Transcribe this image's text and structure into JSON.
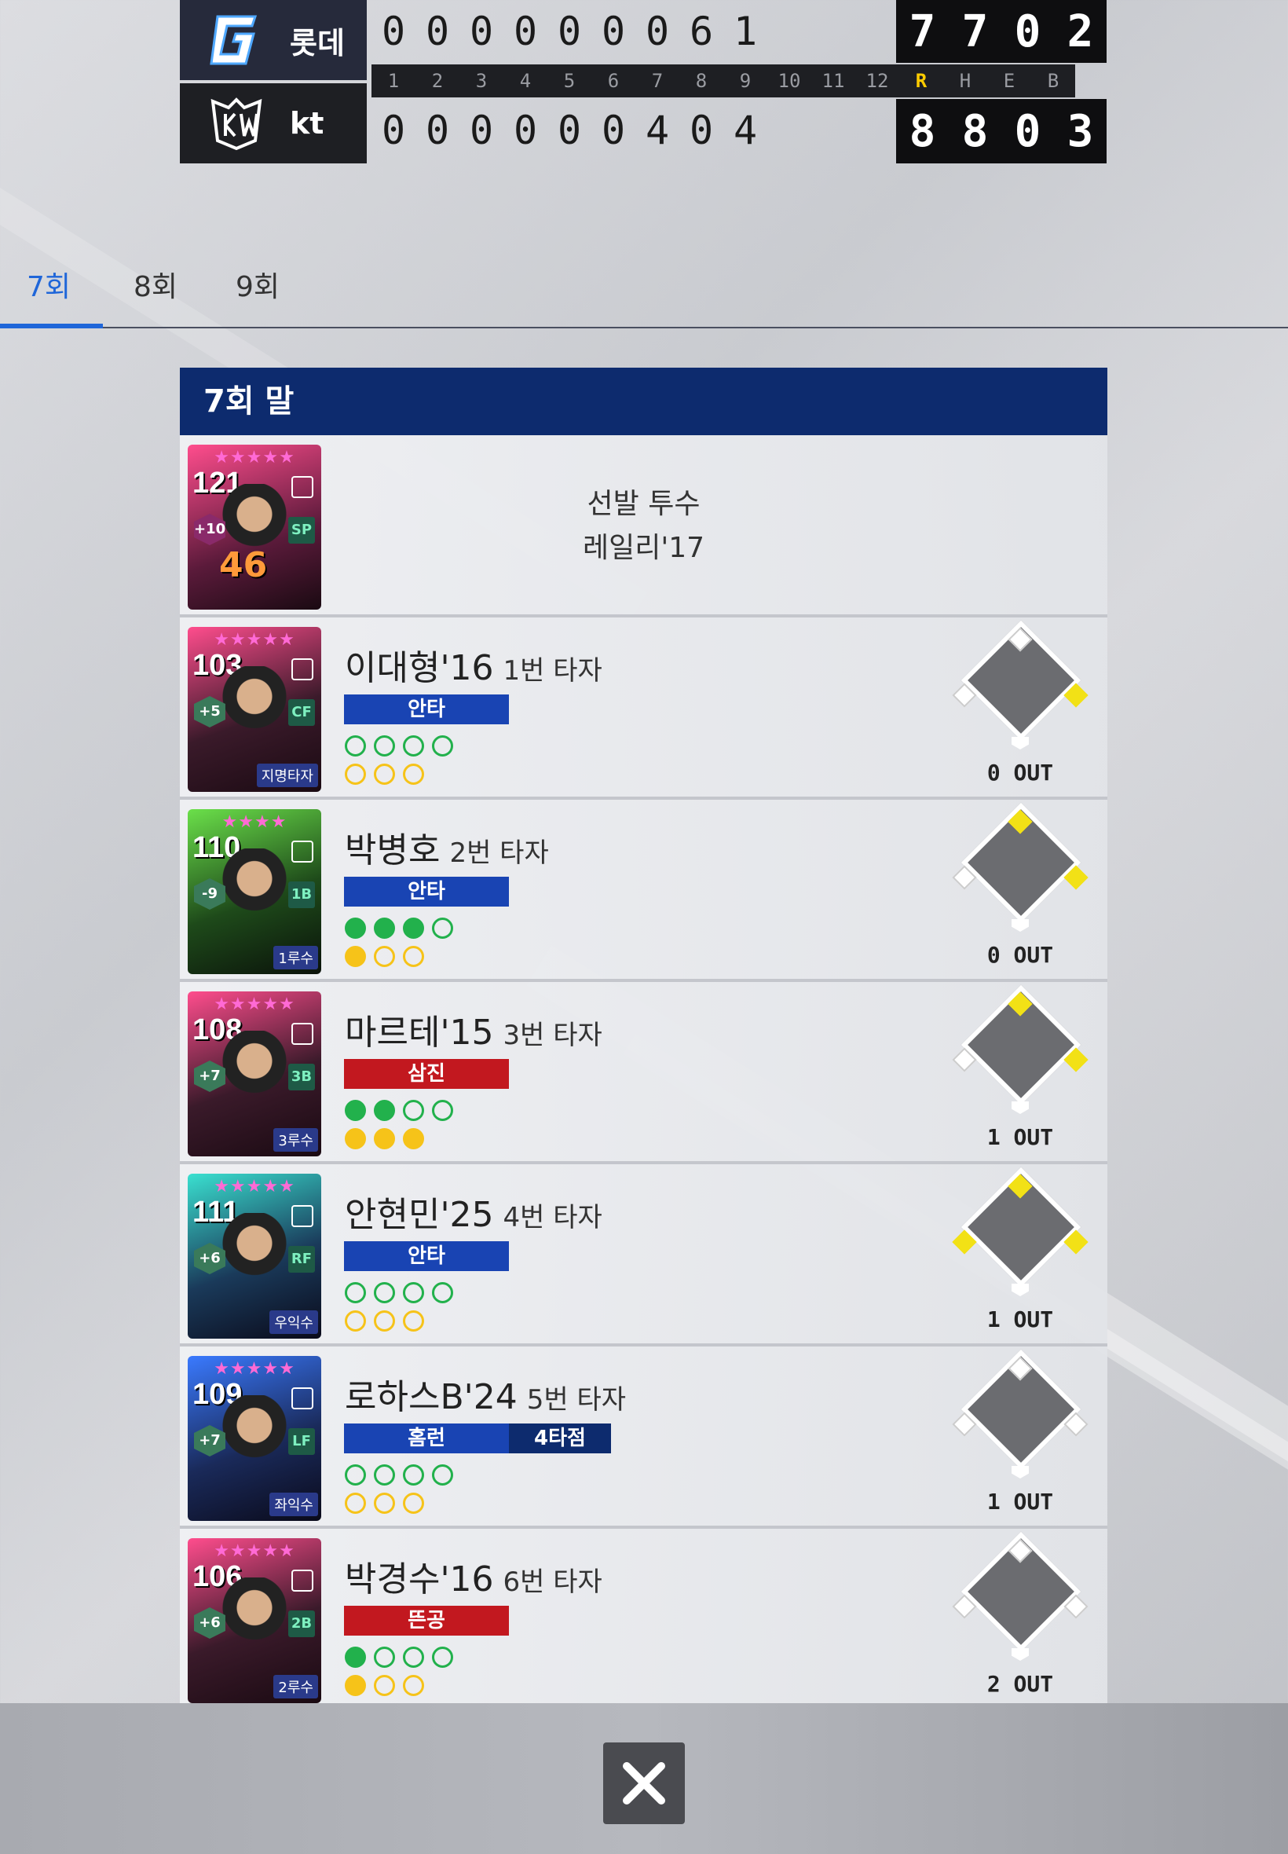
{
  "scoreboard": {
    "away": {
      "name": "롯데",
      "innings": [
        "0",
        "0",
        "0",
        "0",
        "0",
        "0",
        "0",
        "6",
        "1"
      ],
      "totals": [
        "7",
        "7",
        "0",
        "2"
      ]
    },
    "home": {
      "name": "kt",
      "innings": [
        "0",
        "0",
        "0",
        "0",
        "0",
        "0",
        "4",
        "0",
        "4"
      ],
      "totals": [
        "8",
        "8",
        "0",
        "3"
      ]
    },
    "inning_labels": [
      "1",
      "2",
      "3",
      "4",
      "5",
      "6",
      "7",
      "8",
      "9",
      "10",
      "11",
      "12"
    ],
    "total_labels": [
      "R",
      "H",
      "E",
      "B"
    ]
  },
  "tabs": [
    {
      "label": "7회"
    },
    {
      "label": "8회"
    },
    {
      "label": "9회"
    }
  ],
  "panel": {
    "header": "7회 말"
  },
  "starter": {
    "line1": "선발 투수",
    "line2": "레일리'17",
    "card": {
      "rating": "121",
      "stars": "★★★★★",
      "plus": "+10",
      "pos": "SP",
      "number": "46",
      "badge": ""
    }
  },
  "batters": [
    {
      "name": "이대형'16",
      "order": "1번 타자",
      "result": "안타",
      "result_type": "hit",
      "rbi": "",
      "balls": [
        false,
        false,
        false,
        false
      ],
      "strikes": [
        false,
        false,
        false
      ],
      "bases": {
        "first": true,
        "second": false,
        "third": false
      },
      "outs": "0 OUT",
      "card": {
        "rating": "103",
        "stars": "★★★★★",
        "plus": "+5",
        "pos": "CF",
        "badge": "지명타자"
      }
    },
    {
      "name": "박병호",
      "order": "2번 타자",
      "result": "안타",
      "result_type": "hit",
      "rbi": "",
      "balls": [
        true,
        true,
        true,
        false
      ],
      "strikes": [
        true,
        false,
        false
      ],
      "bases": {
        "first": true,
        "second": true,
        "third": false
      },
      "outs": "0 OUT",
      "card": {
        "rating": "110",
        "stars": "★★★★",
        "plus": "-9",
        "pos": "1B",
        "badge": "1루수"
      }
    },
    {
      "name": "마르테'15",
      "order": "3번 타자",
      "result": "삼진",
      "result_type": "out",
      "rbi": "",
      "balls": [
        true,
        true,
        false,
        false
      ],
      "strikes": [
        true,
        true,
        true
      ],
      "bases": {
        "first": true,
        "second": true,
        "third": false
      },
      "outs": "1 OUT",
      "card": {
        "rating": "108",
        "stars": "★★★★★",
        "plus": "+7",
        "pos": "3B",
        "badge": "3루수"
      }
    },
    {
      "name": "안현민'25",
      "order": "4번 타자",
      "result": "안타",
      "result_type": "hit",
      "rbi": "",
      "balls": [
        false,
        false,
        false,
        false
      ],
      "strikes": [
        false,
        false,
        false
      ],
      "bases": {
        "first": true,
        "second": true,
        "third": true
      },
      "outs": "1 OUT",
      "card": {
        "rating": "111",
        "stars": "★★★★★",
        "plus": "+6",
        "pos": "RF",
        "badge": "우익수"
      }
    },
    {
      "name": "로하스B'24",
      "order": "5번 타자",
      "result": "홈런",
      "result_type": "hit",
      "rbi": "4타점",
      "balls": [
        false,
        false,
        false,
        false
      ],
      "strikes": [
        false,
        false,
        false
      ],
      "bases": {
        "first": false,
        "second": false,
        "third": false
      },
      "outs": "1 OUT",
      "card": {
        "rating": "109",
        "stars": "★★★★★",
        "plus": "+7",
        "pos": "LF",
        "badge": "좌익수"
      }
    },
    {
      "name": "박경수'16",
      "order": "6번 타자",
      "result": "뜬공",
      "result_type": "out",
      "rbi": "",
      "balls": [
        true,
        false,
        false,
        false
      ],
      "strikes": [
        true,
        false,
        false
      ],
      "bases": {
        "first": false,
        "second": false,
        "third": false
      },
      "outs": "2 OUT",
      "card": {
        "rating": "106",
        "stars": "★★★★★",
        "plus": "+6",
        "pos": "2B",
        "badge": "2루수"
      }
    }
  ],
  "colors": {
    "accent": "#1f66d9",
    "header": "#0d2b6e",
    "hit": "#1944b3",
    "out": "#c2181f",
    "ball": "#22b14c",
    "strike": "#f6c319",
    "runner": "#f2e116"
  },
  "icons": {
    "close": "close-icon",
    "away_logo": "giants-logo",
    "home_logo": "kt-wiz-logo"
  }
}
